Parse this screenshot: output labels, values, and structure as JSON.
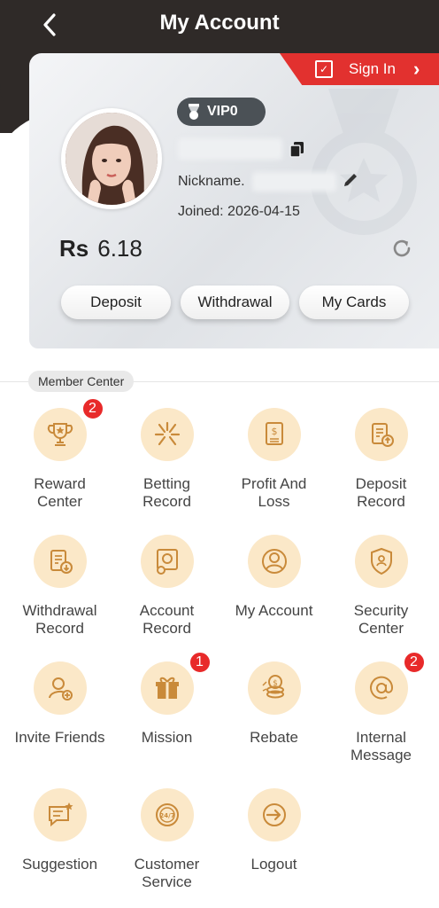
{
  "header": {
    "title": "My Account"
  },
  "card": {
    "signin_label": "Sign In",
    "vip_label": "VIP0",
    "nickname_label": "Nickname.",
    "joined_label": "Joined: 2026-04-15",
    "balance_currency": "Rs",
    "balance_value": "6.18",
    "buttons": {
      "deposit": "Deposit",
      "withdrawal": "Withdrawal",
      "my_cards": "My Cards"
    }
  },
  "member_center": {
    "title": "Member Center",
    "items": [
      {
        "label": "Reward\nCenter",
        "icon": "trophy-icon",
        "badge": "2"
      },
      {
        "label": "Betting\nRecord",
        "icon": "betting-icon",
        "badge": ""
      },
      {
        "label": "Profit And\nLoss",
        "icon": "profit-icon",
        "badge": ""
      },
      {
        "label": "Deposit\nRecord",
        "icon": "deposit-record-icon",
        "badge": ""
      },
      {
        "label": "Withdrawal\nRecord",
        "icon": "withdrawal-record-icon",
        "badge": ""
      },
      {
        "label": "Account\nRecord",
        "icon": "account-record-icon",
        "badge": ""
      },
      {
        "label": "My Account",
        "icon": "user-icon",
        "badge": ""
      },
      {
        "label": "Security\nCenter",
        "icon": "shield-icon",
        "badge": ""
      },
      {
        "label": "Invite Friends",
        "icon": "invite-icon",
        "badge": ""
      },
      {
        "label": "Mission",
        "icon": "gift-icon",
        "badge": "1"
      },
      {
        "label": "Rebate",
        "icon": "coins-icon",
        "badge": ""
      },
      {
        "label": "Internal\nMessage",
        "icon": "at-icon",
        "badge": "2"
      },
      {
        "label": "Suggestion",
        "icon": "suggestion-icon",
        "badge": ""
      },
      {
        "label": "Customer\nService",
        "icon": "service-icon",
        "badge": ""
      },
      {
        "label": "Logout",
        "icon": "logout-icon",
        "badge": ""
      }
    ]
  },
  "colors": {
    "header_bg": "#2f2a28",
    "ribbon": "#e2312f",
    "icon_bg": "#fbe8c8",
    "icon_stroke": "#c98a3a",
    "badge": "#e82a2a"
  }
}
